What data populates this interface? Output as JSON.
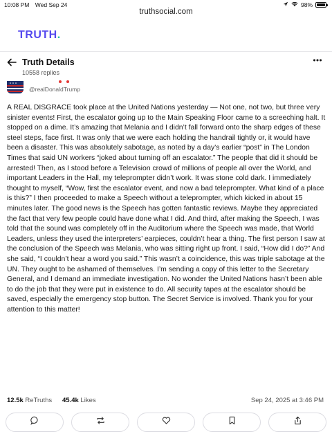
{
  "statusbar": {
    "time": "10:08 PM",
    "date": "Wed Sep 24",
    "battery": "98%",
    "battery_level": 0.98
  },
  "browser": {
    "url": "truthsocial.com"
  },
  "brand": {
    "name": "TRUTH",
    "dot": "."
  },
  "header": {
    "title": "Truth Details",
    "replies": "10558 replies"
  },
  "author": {
    "handle": "@realDonaldTrump"
  },
  "post": {
    "text": "A REAL DISGRACE took place at the United Nations yesterday — Not one, not two, but three very sinister events! First, the escalator going up to the Main Speaking Floor came to a screeching halt. It stopped on a dime. It’s amazing that Melania and I didn’t fall forward onto the sharp edges of these steel steps, face first. It was only that we were each holding the handrail tightly or, it would have been a disaster. This was absolutely sabotage, as noted by a day’s earlier “post” in The London Times that said UN workers “joked about turning off an escalator.” The people that did it should be arrested! Then, as I stood before a Television crowd of millions of people all over the World, and important Leaders in the Hall, my teleprompter didn’t work. It was stone cold dark. I immediately thought to myself, “Wow, first the escalator event, and now a bad teleprompter. What kind of a place is this?” I then proceeded to make a Speech without a teleprompter, which kicked in about 15 minutes later. The good news is the Speech has gotten fantastic reviews. Maybe they appreciated the fact that very few people could have done what I did. And third, after making the Speech, I was told that the sound was completely off in the Auditorium where the Speech was made, that World Leaders, unless they used the interpreters’ earpieces, couldn’t hear a thing. The first person I saw at the conclusion of the Speech was Melania, who was sitting right up front. I said, “How did I do?” And she said, “I couldn’t hear a word you said.” This wasn’t a coincidence, this was triple sabotage at the UN. They ought to be ashamed of themselves. I’m sending a copy of this letter to the Secretary General, and I demand an immediate investigation. No wonder the United Nations hasn’t been able to do the job that they were put in existence to do. All security tapes at the escalator should be saved, especially the emergency stop button. The Secret Service is involved. Thank you for your attention to this matter!"
  },
  "stats": {
    "retruths_count": "12.5k",
    "retruths_label": "ReTruths",
    "likes_count": "45.4k",
    "likes_label": "Likes",
    "timestamp": "Sep 24, 2025 at 3:46 PM"
  },
  "colors": {
    "brand": "#5448ee",
    "brand_dot": "#24c1a3",
    "border": "#dcdce2"
  },
  "actions": [
    {
      "name": "reply",
      "icon": "comment-icon"
    },
    {
      "name": "retruth",
      "icon": "repost-icon"
    },
    {
      "name": "like",
      "icon": "heart-icon"
    },
    {
      "name": "bookmark",
      "icon": "bookmark-icon"
    },
    {
      "name": "share",
      "icon": "share-icon"
    }
  ]
}
